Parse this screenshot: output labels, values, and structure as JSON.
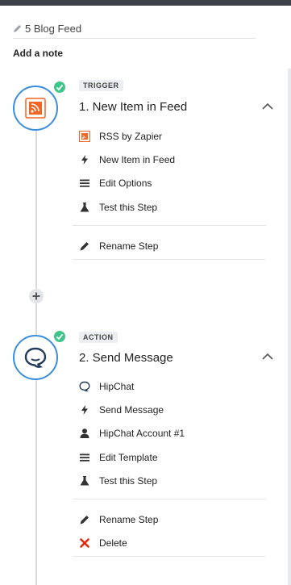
{
  "header": {
    "title": "5 Blog Feed",
    "add_note_label": "Add a note"
  },
  "colors": {
    "accent_blue": "#3b8de0",
    "success_green": "#3ec58c",
    "rss_orange": "#f26522",
    "delete_red": "#e8280b"
  },
  "steps": [
    {
      "type_label": "TRIGGER",
      "title": "1. New Item in Feed",
      "app_icon": "rss-icon",
      "items": [
        {
          "icon": "rss-icon",
          "label": "RSS by Zapier"
        },
        {
          "icon": "bolt-icon",
          "label": "New Item in Feed"
        },
        {
          "icon": "list-icon",
          "label": "Edit Options"
        },
        {
          "icon": "flask-icon",
          "label": "Test this Step"
        }
      ],
      "actions": [
        {
          "icon": "pencil-icon",
          "label": "Rename Step"
        }
      ]
    },
    {
      "type_label": "ACTION",
      "title": "2. Send Message",
      "app_icon": "hipchat-icon",
      "items": [
        {
          "icon": "hipchat-icon",
          "label": "HipChat"
        },
        {
          "icon": "bolt-icon",
          "label": "Send Message"
        },
        {
          "icon": "user-icon",
          "label": "HipChat Account #1"
        },
        {
          "icon": "list-icon",
          "label": "Edit Template"
        },
        {
          "icon": "flask-icon",
          "label": "Test this Step"
        }
      ],
      "actions": [
        {
          "icon": "pencil-icon",
          "label": "Rename Step"
        },
        {
          "icon": "close-icon",
          "label": "Delete"
        }
      ]
    }
  ]
}
